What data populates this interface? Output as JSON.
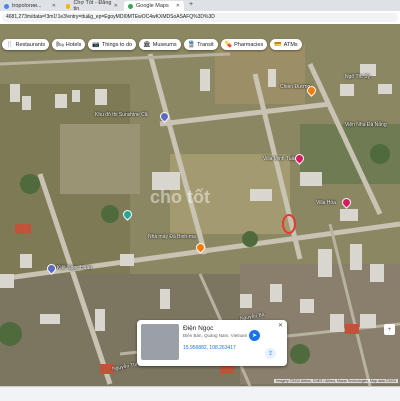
{
  "browser": {
    "tabs": [
      {
        "label": "tropoloгии...",
        "favicon_color": "#4285f4"
      },
      {
        "label": "Chợ Tốt - Đăng tin",
        "favicon_color": "#f4b400"
      },
      {
        "label": "Google Maps",
        "favicon_color": "#34a853"
      }
    ],
    "url": "4681,273m/data=!3m1!1e3!entry=ttu&g_ep=EgoyMDI0MTEwOC4wKXMDSoASAFQ%3D%3D"
  },
  "map": {
    "categories": [
      {
        "label": "Restaurants",
        "icon": "fork-knife-icon"
      },
      {
        "label": "Hotels",
        "icon": "bed-icon"
      },
      {
        "label": "Things to do",
        "icon": "camera-icon"
      },
      {
        "label": "Museums",
        "icon": "museum-icon"
      },
      {
        "label": "Transit",
        "icon": "train-icon"
      },
      {
        "label": "Pharmacies",
        "icon": "pill-icon"
      },
      {
        "label": "ATMs",
        "icon": "atm-icon"
      }
    ],
    "labels": [
      {
        "text": "Ngô Thì Sỹ",
        "name": "label-ngo-thi-sy"
      },
      {
        "text": "Chiền Đương",
        "name": "label-chien-duong"
      },
      {
        "text": "Viện Nha Đà Nẵng",
        "name": "label-vien-nha"
      },
      {
        "text": "Khu đô thị Sunshine Că",
        "name": "label-khu-do-thi"
      },
      {
        "text": "Villa Minh Tuấn",
        "name": "label-villa-minh"
      },
      {
        "text": "Villa Hòa",
        "name": "label-villa-hoa"
      },
      {
        "text": "Nhà máy Đá Binh-ma",
        "name": "label-nha-may"
      },
      {
        "text": "Kiệt Ngọc Huân",
        "name": "label-kiet"
      },
      {
        "text": "Nguyễn Bá",
        "name": "label-nguyen-ba"
      },
      {
        "text": "Nguyễn Thị",
        "name": "label-nguyen-thi"
      }
    ],
    "watermark": "cho tốt"
  },
  "place_card": {
    "title": "Điện Ngọc",
    "subtitle": "Điện Bàn, Quảng Nam, Vietnam",
    "coords": "15.956882, 108.263417"
  },
  "attribution": "Imagery ©2024 Airbus, CNES / Airbus, Maxar Technologies, Map data ©2024",
  "colors": {
    "marker": "#e53935",
    "accent": "#1a73e8",
    "poi_orange": "#f57c00"
  }
}
